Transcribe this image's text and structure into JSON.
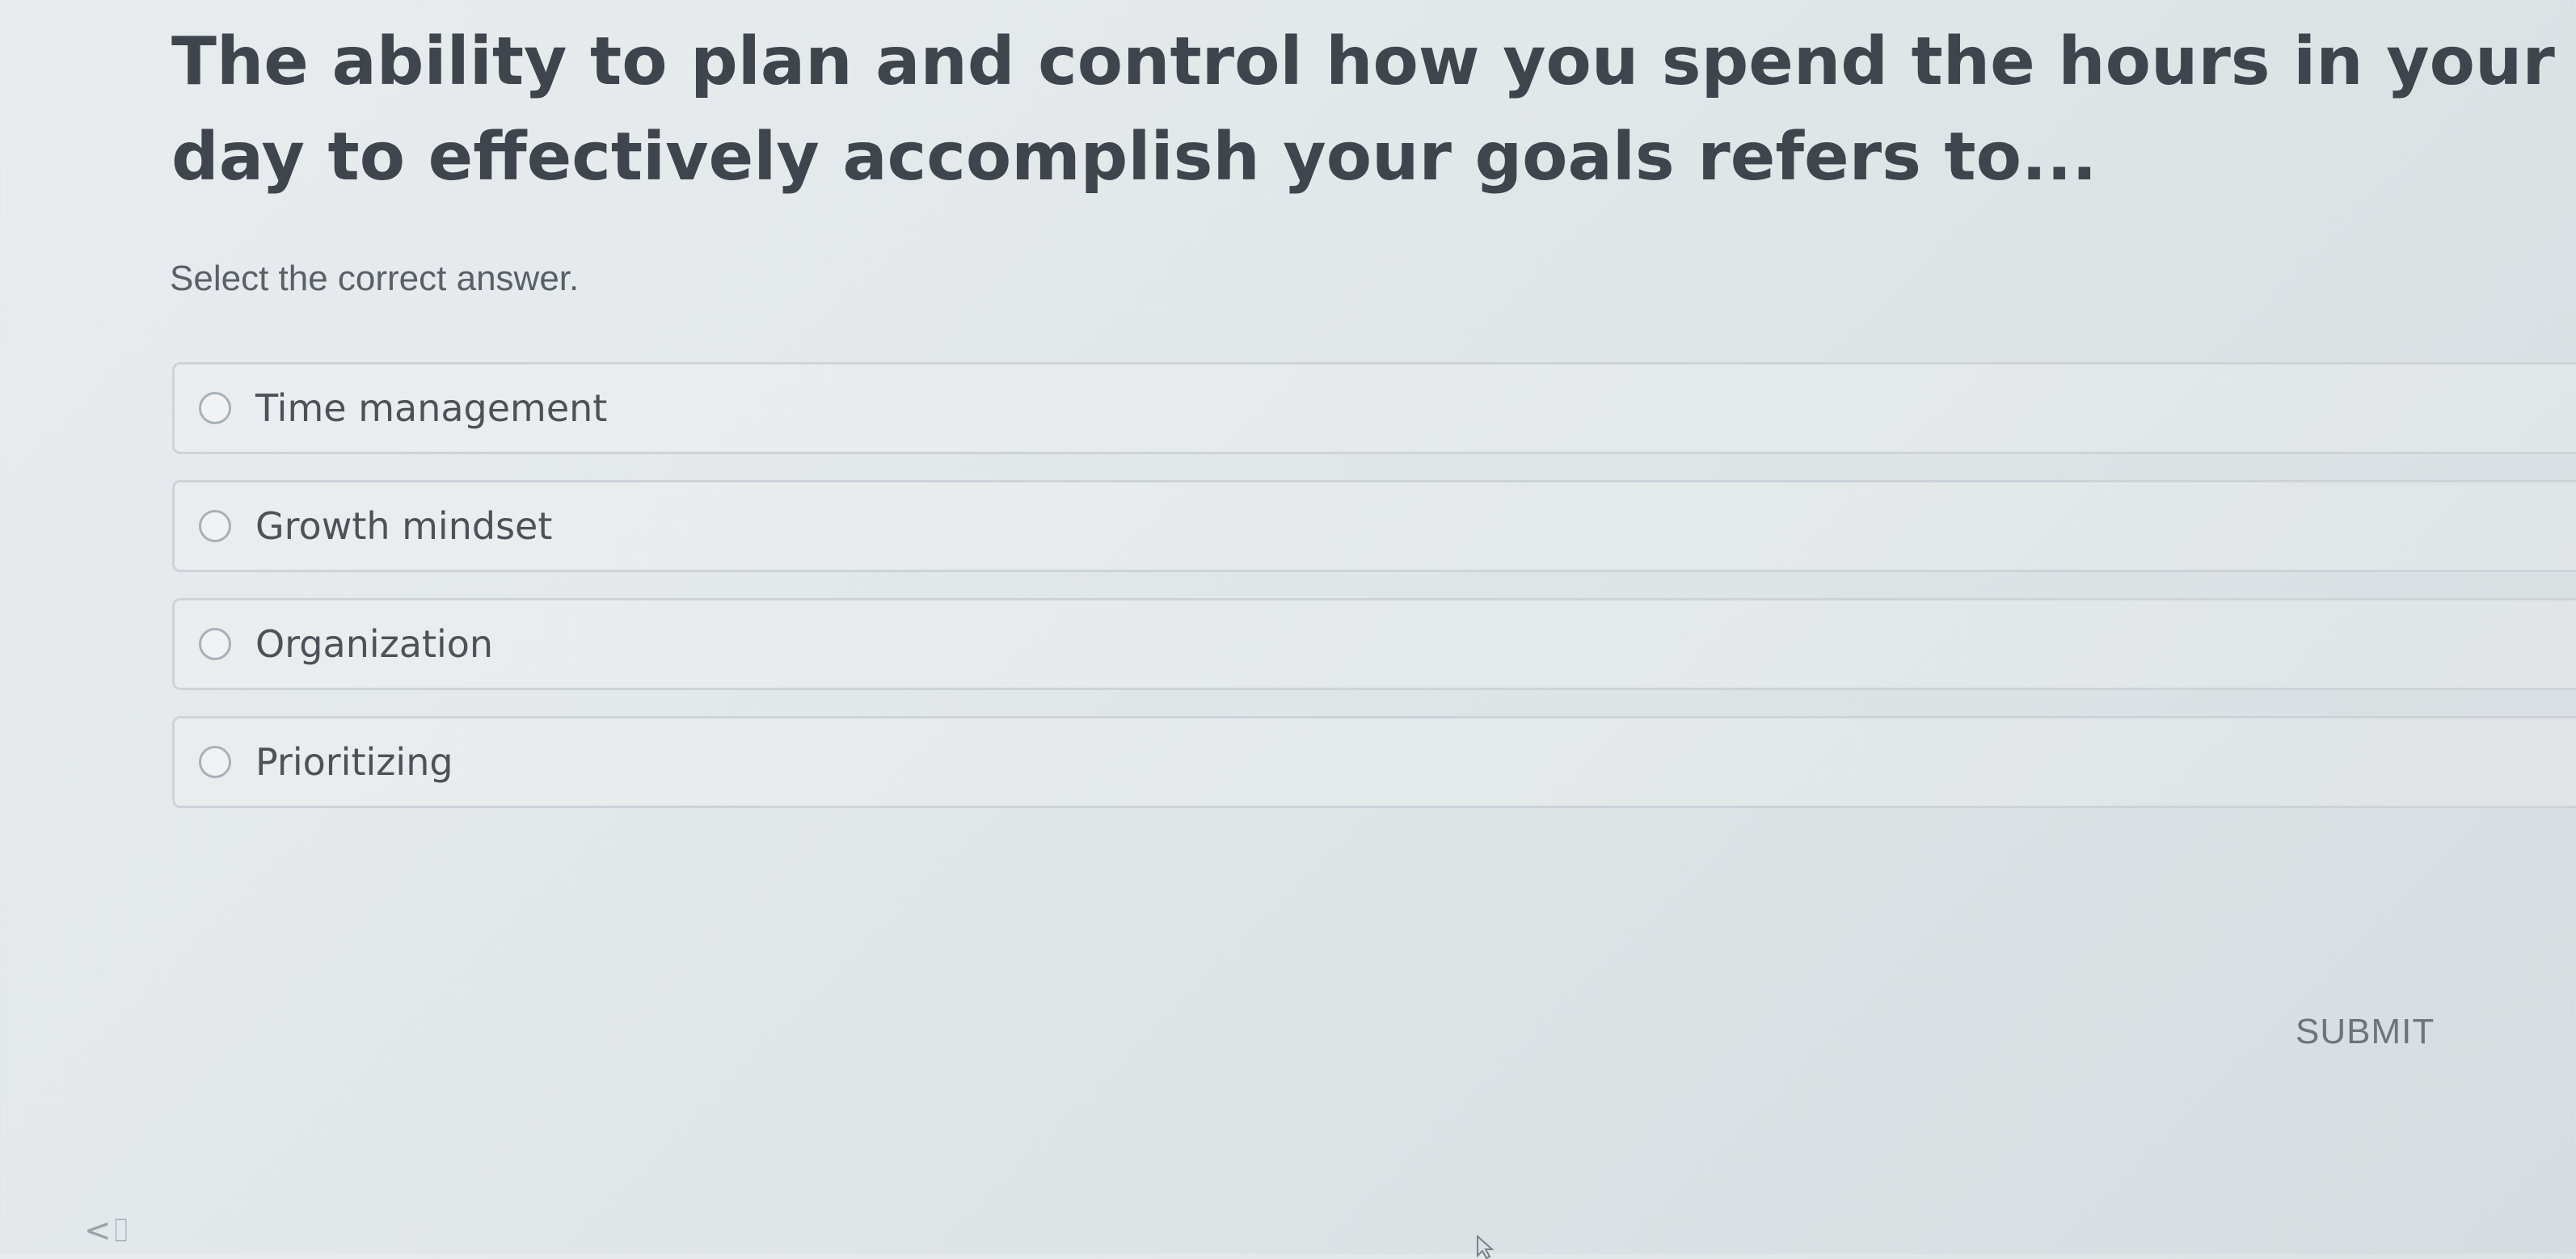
{
  "question": {
    "text": "The ability to plan and control how you spend the hours in your day to effectively accomplish your goals refers to..."
  },
  "instruction": "Select the correct answer.",
  "options": [
    {
      "label": "Time management",
      "selected": false
    },
    {
      "label": "Growth mindset",
      "selected": false
    },
    {
      "label": "Organization",
      "selected": false
    },
    {
      "label": "Prioritizing",
      "selected": false
    }
  ],
  "submit_label": "SUBMIT",
  "nav_glyph": "<⌷",
  "icons": {
    "radio": "radio-circle-icon",
    "cursor": "mouse-pointer-icon"
  }
}
